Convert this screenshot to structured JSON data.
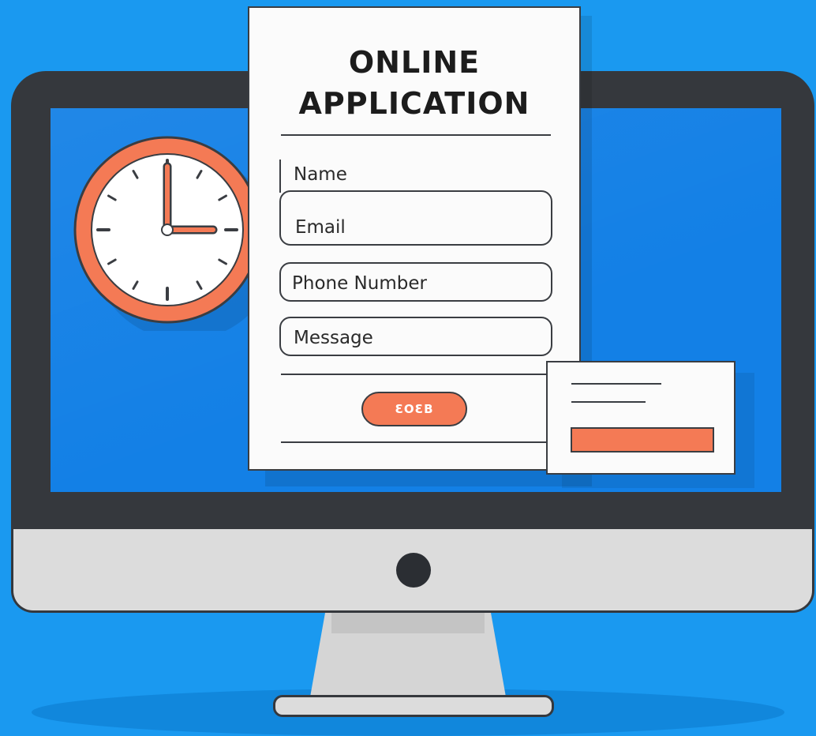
{
  "form": {
    "title_line1": "ONLINE",
    "title_line2": "APPLICATION",
    "fields": {
      "name": "Name",
      "email": "Email",
      "phone": "Phone Number",
      "message": "Message"
    },
    "submit_label": "ƐOƐB"
  },
  "colors": {
    "background": "#1a99f0",
    "screen": "#1380e6",
    "bezel": "#35383d",
    "accent": "#f47a55",
    "card": "#fbfbfb"
  },
  "clock": {
    "hour_hand": "12",
    "minute_hand": "3"
  },
  "icons": [
    "clock-icon",
    "monitor-illustration"
  ]
}
